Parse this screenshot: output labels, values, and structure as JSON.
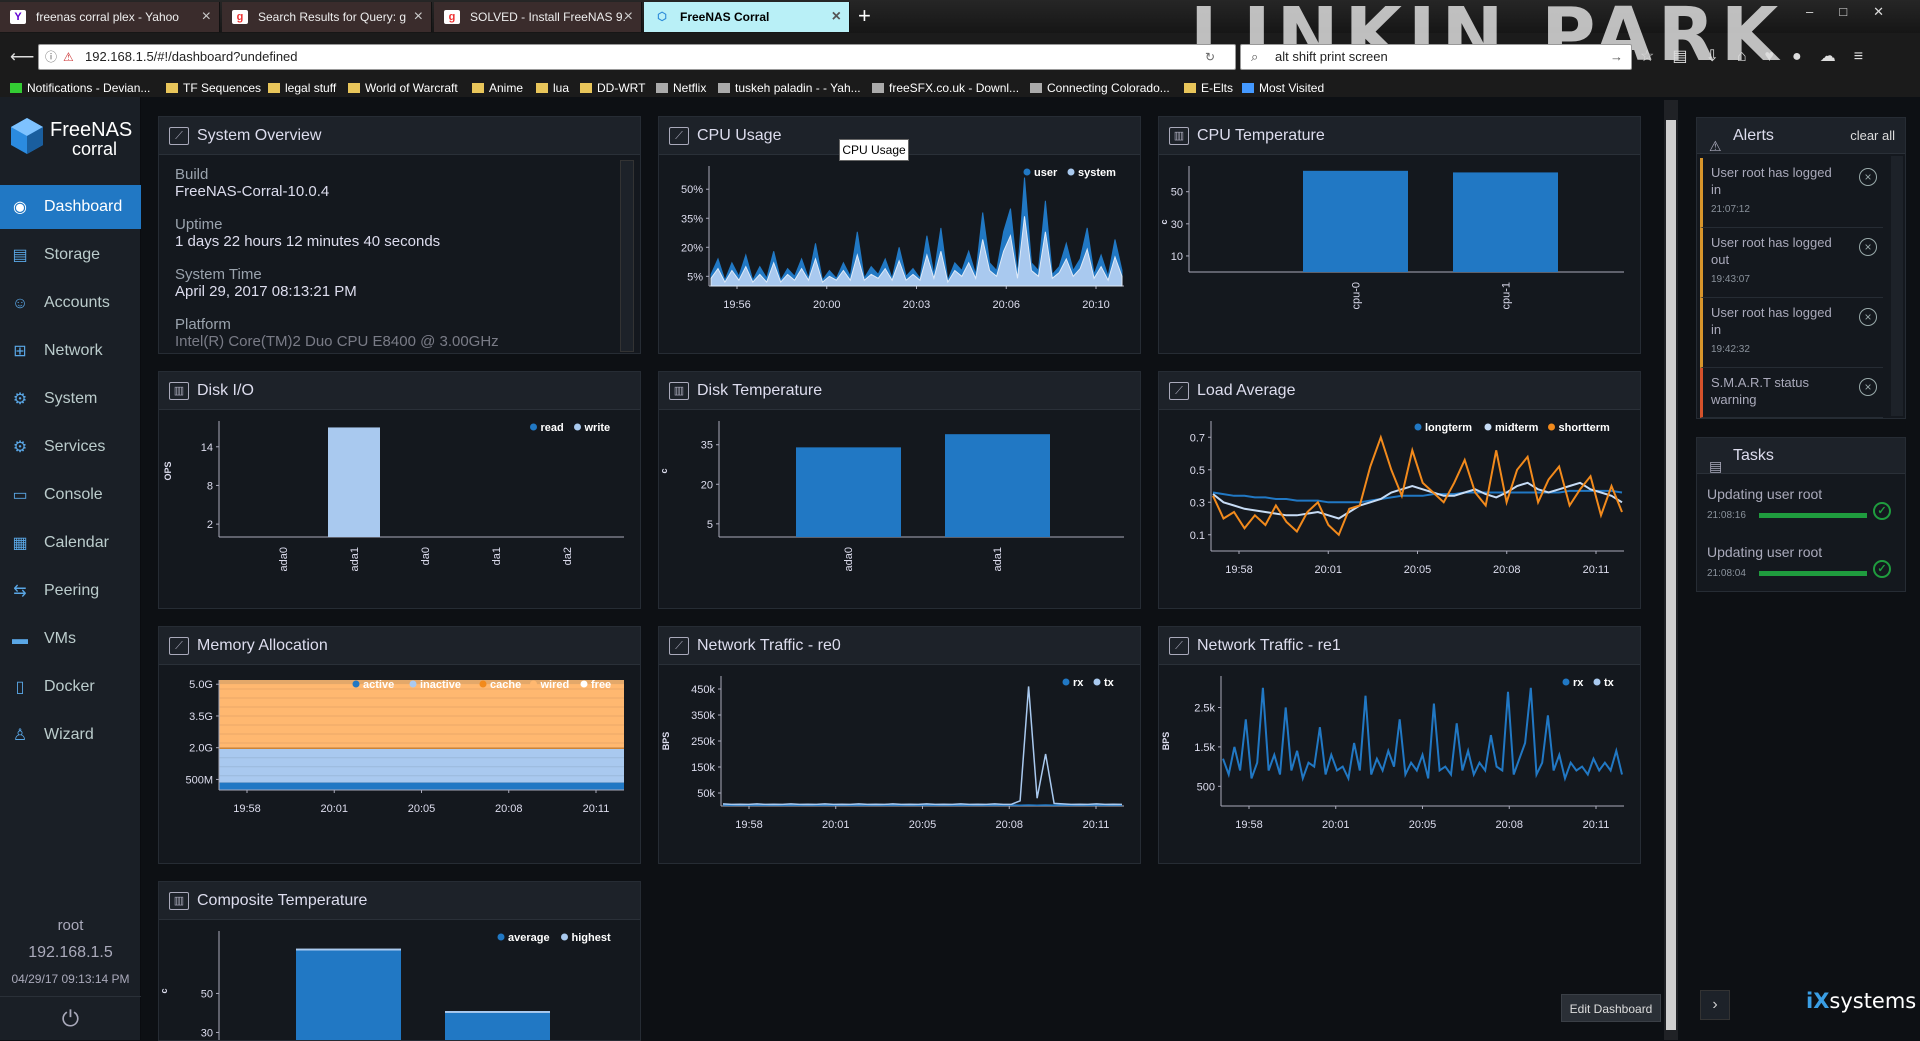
{
  "browser": {
    "tabs": [
      {
        "label": "freenas corral plex - Yahoo",
        "icon": "Y",
        "icon_color": "#6001d2"
      },
      {
        "label": "Search Results for Query: g",
        "icon": "g",
        "icon_color": "#e33"
      },
      {
        "label": "SOLVED - Install FreeNAS 9.",
        "icon": "g",
        "icon_color": "#e33"
      },
      {
        "label": "FreeNAS Corral",
        "icon": "⬡",
        "icon_color": "#2a8ad8"
      }
    ],
    "url": "192.168.1.5/#!/dashboard?undefined",
    "search_value": "alt shift print screen",
    "background_brand": "LINKIN PARK",
    "bookmarks": [
      "Notifications - Devian...",
      "TF Sequences",
      "legal stuff",
      "World of Warcraft",
      "Anime",
      "lua",
      "DD-WRT",
      "Netflix",
      "tuskeh paladin - - Yah...",
      "freeSFX.co.uk - Downl...",
      "Connecting Colorado...",
      "E-Elts",
      "Most Visited"
    ]
  },
  "app": {
    "logo_line1": "FreeNAS",
    "logo_line2": "corral",
    "nav": [
      {
        "label": "Dashboard",
        "icon": "dashboard-icon",
        "glyph": "◉"
      },
      {
        "label": "Storage",
        "icon": "storage-icon",
        "glyph": "▤"
      },
      {
        "label": "Accounts",
        "icon": "accounts-icon",
        "glyph": "☺"
      },
      {
        "label": "Network",
        "icon": "network-icon",
        "glyph": "⊞"
      },
      {
        "label": "System",
        "icon": "system-icon",
        "glyph": "⚙"
      },
      {
        "label": "Services",
        "icon": "services-icon",
        "glyph": "⚙"
      },
      {
        "label": "Console",
        "icon": "console-icon",
        "glyph": "▭"
      },
      {
        "label": "Calendar",
        "icon": "calendar-icon",
        "glyph": "▦"
      },
      {
        "label": "Peering",
        "icon": "peering-icon",
        "glyph": "⇆"
      },
      {
        "label": "VMs",
        "icon": "vms-icon",
        "glyph": "▬"
      },
      {
        "label": "Docker",
        "icon": "docker-icon",
        "glyph": "▯"
      },
      {
        "label": "Wizard",
        "icon": "wizard-icon",
        "glyph": "♙"
      }
    ],
    "user": "root",
    "host": "192.168.1.5",
    "time": "04/29/17  09:13:14 PM"
  },
  "system_overview": {
    "title": "System Overview",
    "rows": [
      {
        "label": "Build",
        "value": "FreeNAS-Corral-10.0.4"
      },
      {
        "label": "Uptime",
        "value": "1 days 22 hours 12 minutes 40 seconds"
      },
      {
        "label": "System Time",
        "value": "April 29, 2017 08:13:21 PM"
      },
      {
        "label": "Platform",
        "value": "Intel(R) Core(TM)2 Duo CPU E8400 @ 3.00GHz"
      }
    ]
  },
  "tooltip": "CPU Usage",
  "edit_dashboard": "Edit Dashboard",
  "alerts": {
    "title": "Alerts",
    "clear_label": "clear all",
    "items": [
      {
        "msg": "User root has logged in",
        "time": "21:07:12",
        "level": "warn"
      },
      {
        "msg": "User root has logged out",
        "time": "19:43:07",
        "level": "warn"
      },
      {
        "msg": "User root has logged in",
        "time": "19:42:32",
        "level": "warn"
      },
      {
        "msg": "S.M.A.R.T status warning",
        "time": "",
        "level": "error"
      }
    ]
  },
  "tasks": {
    "title": "Tasks",
    "items": [
      {
        "name": "Updating user root",
        "time": "21:08:16",
        "progress": 1.0
      },
      {
        "name": "Updating user root",
        "time": "21:08:04",
        "progress": 1.0
      }
    ]
  },
  "vendor": {
    "prefix": "iX",
    "name": "systems"
  },
  "chart_data": [
    {
      "id": "cpu-usage",
      "title": "CPU Usage",
      "type": "area",
      "x": [
        "19:56",
        "20:00",
        "20:03",
        "20:06",
        "20:10"
      ],
      "yticks": [
        "5%",
        "20%",
        "35%",
        "50%"
      ],
      "ylim": [
        0,
        62
      ],
      "series": [
        {
          "name": "user",
          "color": "#2178c4",
          "values": [
            6,
            14,
            3,
            12,
            5,
            16,
            3,
            10,
            4,
            18,
            3,
            9,
            5,
            14,
            4,
            22,
            3,
            8,
            4,
            12,
            5,
            28,
            4,
            10,
            6,
            14,
            4,
            20,
            5,
            9,
            4,
            26,
            6,
            30,
            3,
            12,
            8,
            18,
            6,
            38,
            12,
            8,
            28,
            40,
            6,
            56,
            12,
            8,
            44,
            6,
            10,
            22,
            8,
            14,
            30,
            6,
            16,
            5,
            24,
            8
          ]
        },
        {
          "name": "system",
          "color": "#a9c9ef",
          "values": [
            4,
            9,
            2,
            8,
            3,
            10,
            2,
            6,
            2,
            12,
            2,
            6,
            3,
            9,
            3,
            14,
            2,
            5,
            3,
            8,
            3,
            16,
            3,
            6,
            4,
            9,
            3,
            13,
            3,
            6,
            3,
            16,
            4,
            18,
            2,
            8,
            5,
            12,
            4,
            24,
            8,
            5,
            18,
            26,
            4,
            36,
            8,
            5,
            28,
            4,
            7,
            14,
            5,
            9,
            19,
            4,
            10,
            3,
            15,
            5
          ]
        }
      ]
    },
    {
      "id": "cpu-temp",
      "title": "CPU Temperature",
      "type": "bar",
      "ylabel": "c",
      "categories": [
        "cpu-0",
        "cpu-1"
      ],
      "values": [
        63,
        62
      ],
      "ylim": [
        0,
        66
      ],
      "yticks": [
        "10",
        "30",
        "50"
      ],
      "color": "#2178c4"
    },
    {
      "id": "disk-io",
      "title": "Disk I/O",
      "type": "bar",
      "ylabel": "OPS",
      "categories": [
        "ada0",
        "ada1",
        "da0",
        "da1",
        "da2"
      ],
      "series": [
        {
          "name": "read",
          "color": "#2178c4",
          "values": [
            0,
            0,
            0,
            0,
            0
          ]
        },
        {
          "name": "write",
          "color": "#a9c9ef",
          "values": [
            0,
            17,
            0,
            0,
            0
          ]
        }
      ],
      "ylim": [
        0,
        18
      ],
      "yticks": [
        "2",
        "8",
        "14"
      ]
    },
    {
      "id": "disk-temp",
      "title": "Disk Temperature",
      "type": "bar",
      "ylabel": "c",
      "categories": [
        "ada0",
        "ada1"
      ],
      "values": [
        34,
        39
      ],
      "ylim": [
        0,
        44
      ],
      "yticks": [
        "5",
        "20",
        "35"
      ],
      "color": "#2178c4"
    },
    {
      "id": "load-avg",
      "title": "Load Average",
      "type": "line",
      "x": [
        "19:58",
        "20:01",
        "20:05",
        "20:08",
        "20:11"
      ],
      "yticks": [
        "0.1",
        "0.3",
        "0.5",
        "0.7"
      ],
      "ylim": [
        0,
        0.8
      ],
      "series": [
        {
          "name": "longterm",
          "color": "#2178c4",
          "values": [
            0.36,
            0.35,
            0.34,
            0.34,
            0.33,
            0.33,
            0.32,
            0.32,
            0.31,
            0.31,
            0.31,
            0.3,
            0.3,
            0.3,
            0.3,
            0.31,
            0.32,
            0.33,
            0.34,
            0.34,
            0.34,
            0.35,
            0.35,
            0.35,
            0.36,
            0.36,
            0.36,
            0.36,
            0.36,
            0.36,
            0.36,
            0.36,
            0.36,
            0.36,
            0.37,
            0.37,
            0.37,
            0.37,
            0.37,
            0.36
          ]
        },
        {
          "name": "midterm",
          "color": "#c7dcf5",
          "values": [
            0.35,
            0.3,
            0.28,
            0.26,
            0.25,
            0.24,
            0.23,
            0.22,
            0.22,
            0.23,
            0.24,
            0.22,
            0.2,
            0.24,
            0.28,
            0.3,
            0.32,
            0.36,
            0.38,
            0.4,
            0.38,
            0.36,
            0.34,
            0.34,
            0.36,
            0.38,
            0.35,
            0.33,
            0.36,
            0.4,
            0.42,
            0.38,
            0.36,
            0.38,
            0.4,
            0.42,
            0.38,
            0.36,
            0.34,
            0.3
          ]
        },
        {
          "name": "shortterm",
          "color": "#f28a1c",
          "values": [
            0.34,
            0.2,
            0.24,
            0.14,
            0.22,
            0.16,
            0.28,
            0.18,
            0.12,
            0.24,
            0.3,
            0.16,
            0.1,
            0.26,
            0.28,
            0.52,
            0.7,
            0.5,
            0.34,
            0.62,
            0.42,
            0.36,
            0.3,
            0.42,
            0.56,
            0.36,
            0.28,
            0.62,
            0.3,
            0.5,
            0.58,
            0.3,
            0.44,
            0.52,
            0.28,
            0.38,
            0.46,
            0.22,
            0.4,
            0.24
          ]
        }
      ]
    },
    {
      "id": "memory",
      "title": "Memory Allocation",
      "type": "area",
      "x": [
        "19:58",
        "20:01",
        "20:05",
        "20:08",
        "20:11"
      ],
      "yticks": [
        "500M",
        "2.0G",
        "3.5G",
        "5.0G"
      ],
      "ylim": [
        0,
        5.2
      ],
      "series": [
        {
          "name": "active",
          "color": "#2178c4",
          "values": [
            0.35
          ]
        },
        {
          "name": "inactive",
          "color": "#a9c9ef",
          "values": [
            1.6
          ]
        },
        {
          "name": "cache",
          "color": "#f28a1c",
          "values": [
            0.05
          ]
        },
        {
          "name": "wired",
          "color": "#ffb870",
          "values": [
            3.2
          ]
        },
        {
          "name": "free",
          "color": "#ffffff",
          "values": [
            0
          ]
        }
      ]
    },
    {
      "id": "net-re0",
      "title": "Network Traffic - re0",
      "type": "area",
      "ylabel": "BPS",
      "x": [
        "19:58",
        "20:01",
        "20:05",
        "20:08",
        "20:11"
      ],
      "yticks": [
        "50k",
        "150k",
        "250k",
        "350k",
        "450k"
      ],
      "ylim": [
        0,
        500000
      ],
      "series": [
        {
          "name": "rx",
          "color": "#2178c4",
          "values": [
            4000,
            3000,
            4000,
            3000,
            4000,
            3000,
            4000,
            3000,
            4000,
            3000,
            4000,
            3000,
            4000,
            3000,
            4000,
            3000,
            4000,
            3000,
            4000,
            3000,
            4000,
            3000,
            4000,
            3000,
            4000,
            3000,
            4000,
            3000,
            4000,
            3000,
            4000,
            3000,
            4000,
            3000,
            4000,
            3000,
            4000,
            3000,
            4000,
            3000,
            4000,
            3000,
            4000,
            3000,
            4000,
            3000,
            4000,
            3000
          ]
        },
        {
          "name": "tx",
          "color": "#a9c9ef",
          "values": [
            8000,
            6000,
            7000,
            6000,
            8000,
            6000,
            7000,
            6000,
            8000,
            6000,
            7000,
            6000,
            8000,
            6000,
            7000,
            6000,
            8000,
            6000,
            7000,
            6000,
            8000,
            6000,
            7000,
            6000,
            8000,
            6000,
            7000,
            6000,
            8000,
            6000,
            7000,
            6000,
            8000,
            6000,
            7000,
            20000,
            460000,
            30000,
            200000,
            10000,
            8000,
            6000,
            7000,
            6000,
            8000,
            6000,
            7000,
            6000
          ]
        }
      ]
    },
    {
      "id": "net-re1",
      "title": "Network Traffic - re1",
      "type": "line",
      "ylabel": "BPS",
      "x": [
        "19:58",
        "20:01",
        "20:05",
        "20:08",
        "20:11"
      ],
      "yticks": [
        "500",
        "1.5k",
        "2.5k"
      ],
      "ylim": [
        0,
        3300
      ],
      "series": [
        {
          "name": "rx",
          "color": "#2178c4",
          "values": [
            1200,
            800,
            1500,
            900,
            2200,
            700,
            1100,
            3000,
            900,
            1300,
            800,
            2500,
            900,
            1400,
            700,
            1100,
            1000,
            2000,
            800,
            1300,
            900,
            1000,
            700,
            1600,
            900,
            2800,
            800,
            1200,
            900,
            1400,
            1000,
            2200,
            800,
            1100,
            900,
            1300,
            700,
            2600,
            900,
            1000,
            800,
            2100,
            900,
            1400,
            800,
            1100,
            900,
            1800,
            1000,
            900,
            2900,
            800,
            1200,
            1600,
            3000,
            800,
            1100,
            2300,
            900,
            1300,
            700,
            1100,
            900,
            1000,
            800,
            1200,
            900,
            1100,
            900,
            1400,
            800
          ]
        },
        {
          "name": "tx",
          "color": "#a9c9ef",
          "values": []
        }
      ]
    },
    {
      "id": "comp-temp",
      "title": "Composite Temperature",
      "type": "bar",
      "ylabel": "c",
      "categories": [
        "",
        ""
      ],
      "series": [
        {
          "name": "average",
          "color": "#2178c4",
          "values": [
            72,
            40
          ]
        },
        {
          "name": "highest",
          "color": "#a9c9ef",
          "values": [
            73,
            41
          ]
        }
      ],
      "ylim": [
        0,
        82
      ],
      "yticks": [
        "30",
        "50"
      ]
    }
  ]
}
